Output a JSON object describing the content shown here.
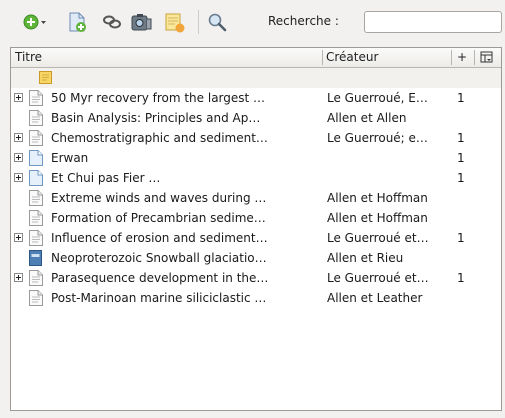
{
  "toolbar": {
    "search_label": "Recherche :",
    "search_value": "",
    "buttons": [
      {
        "name": "add-menu-button",
        "icon": "green-plus-dropdown-icon"
      },
      {
        "name": "new-item-button",
        "icon": "new-document-icon"
      },
      {
        "name": "link-button",
        "icon": "link-icon"
      },
      {
        "name": "snapshot-button",
        "icon": "camera-icon"
      },
      {
        "name": "new-note-button",
        "icon": "note-icon"
      },
      {
        "name": "search-button",
        "icon": "magnifier-icon"
      }
    ]
  },
  "columns": {
    "title": "Titre",
    "creator": "Créateur",
    "count": "+",
    "picker": "column-picker-icon"
  },
  "rows": [
    {
      "type": "note",
      "expandable": false,
      "title": "",
      "creator": "",
      "count": ""
    },
    {
      "type": "document",
      "expandable": true,
      "title": "50 Myr recovery from the largest …",
      "creator": "Le Guerroué, E…",
      "count": "1"
    },
    {
      "type": "document",
      "expandable": false,
      "title": "Basin Analysis: Principles and Ap…",
      "creator": "Allen et Allen",
      "count": ""
    },
    {
      "type": "document",
      "expandable": true,
      "title": "Chemostratigraphic and sediment…",
      "creator": "Le Guerroué; e…",
      "count": "1"
    },
    {
      "type": "blank-page",
      "expandable": true,
      "title": "Erwan",
      "creator": "",
      "count": "1"
    },
    {
      "type": "blank-page",
      "expandable": true,
      "title": "Et Chui pas Fier …",
      "creator": "",
      "count": "1"
    },
    {
      "type": "document",
      "expandable": false,
      "title": "Extreme winds and waves during …",
      "creator": "Allen et Hoffman",
      "count": ""
    },
    {
      "type": "document",
      "expandable": false,
      "title": "Formation of Precambrian sedime…",
      "creator": "Allen et Hoffman",
      "count": ""
    },
    {
      "type": "document",
      "expandable": true,
      "title": "Influence of erosion and sediment…",
      "creator": "Le Guerroué et…",
      "count": "1"
    },
    {
      "type": "book",
      "expandable": false,
      "title": "Neoproterozoic Snowball glaciatio…",
      "creator": "Allen et Rieu",
      "count": ""
    },
    {
      "type": "document",
      "expandable": true,
      "title": "Parasequence development in the…",
      "creator": "Le Guerroué et…",
      "count": "1"
    },
    {
      "type": "document",
      "expandable": false,
      "title": "Post-Marinoan marine siliciclastic …",
      "creator": "Allen et Leather",
      "count": ""
    }
  ]
}
